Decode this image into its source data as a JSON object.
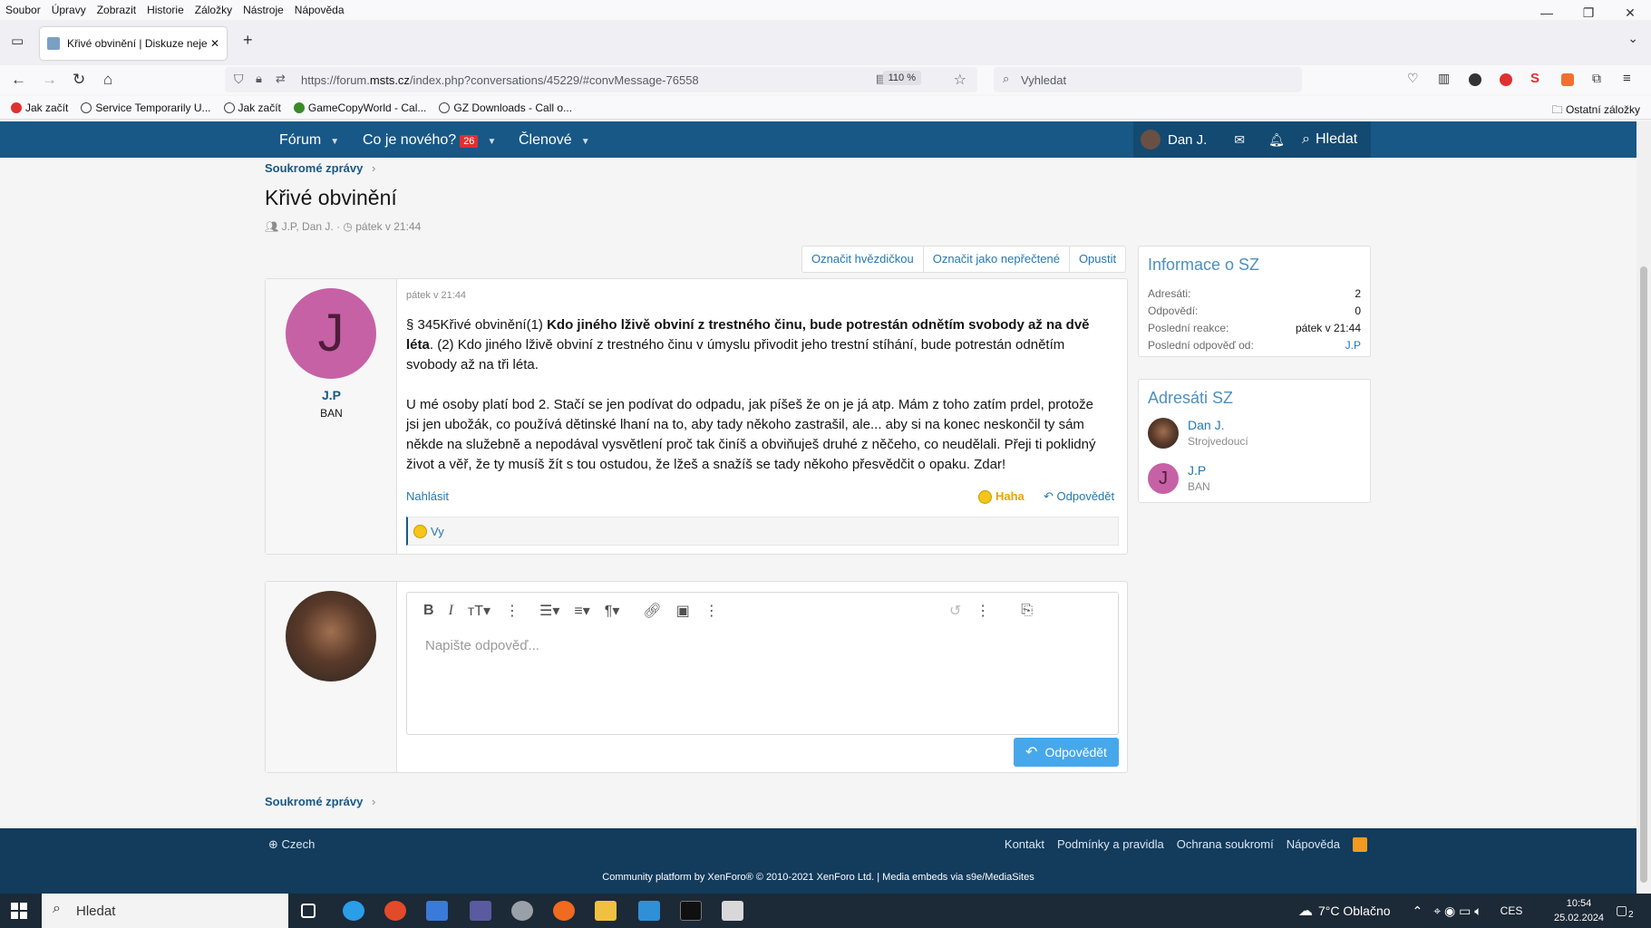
{
  "browser": {
    "menu": [
      "Soubor",
      "Úpravy",
      "Zobrazit",
      "Historie",
      "Záložky",
      "Nástroje",
      "Nápověda"
    ],
    "tab_title": "Křivé obvinění | Diskuze nejen o",
    "url_prefix": "https://forum.",
    "url_host": "msts.cz",
    "url_path": "/index.php?conversations/45229/#convMessage-76558",
    "zoom": "110 %",
    "search_placeholder": "Vyhledat",
    "bookmarks": [
      "Jak začít",
      "Service Temporarily U...",
      "Jak začít",
      "GameCopyWorld - Cal...",
      "GZ Downloads - Call o..."
    ],
    "other_bookmarks": "Ostatní záložky"
  },
  "site_nav": {
    "forum": "Fórum",
    "whats_new": "Co je nového?",
    "whats_new_count": "26",
    "members": "Členové",
    "user": "Dan J.",
    "search": "Hledat"
  },
  "breadcrumb": "Soukromé zprávy",
  "page_title": "Křivé obvinění",
  "page_meta": {
    "participants": "J.P, Dan J.",
    "separator": "·",
    "date": "pátek v 21:44"
  },
  "actions": {
    "star": "Označit hvězdičkou",
    "unread": "Označit jako nepřečtené",
    "leave": "Opustit"
  },
  "message": {
    "author_initial": "J",
    "author": "J.P",
    "author_title": "BAN",
    "date": "pátek v 21:44",
    "p1_start": "§ 345Křivé obvinění(1) ",
    "p1_bold": "Kdo jiného lživě obviní z trestného činu, bude potrestán odnětím svobody až na dvě léta",
    "p1_end": ". (2) Kdo jiného lživě obviní z trestného činu v úmyslu přivodit jeho trestní stíhání, bude potrestán odnětím svobody až na tři léta.",
    "p2": "U mé osoby platí bod 2. Stačí se jen podívat do odpadu, jak píšeš že on je já atp. Mám z toho zatím prdel, protože jsi jen ubožák, co používá dětinské lhaní na to, aby tady někoho zastrašil, ale... aby si na konec neskončil ty sám někde na služebně a nepodával vysvětlení proč tak činíš a obviňuješ druhé z něčeho, co neudělali. Přeji ti poklidný život a věř, že ty musíš žít s tou ostudou, že lžeš a snažíš se tady někoho přesvědčit o opaku. Zdar!",
    "report": "Nahlásit",
    "reaction": "Haha",
    "reply": "Odpovědět",
    "reacted_by": "Vy"
  },
  "editor": {
    "placeholder": "Napište odpověď...",
    "submit": "Odpovědět"
  },
  "sidebar": {
    "info_title": "Informace o SZ",
    "rows": [
      {
        "k": "Adresáti:",
        "v": "2"
      },
      {
        "k": "Odpovědí:",
        "v": "0"
      },
      {
        "k": "Poslední reakce:",
        "v": "pátek v 21:44"
      },
      {
        "k": "Poslední odpověď od:",
        "v": "J.P"
      }
    ],
    "recipients_title": "Adresáti SZ",
    "members": [
      {
        "name": "Dan J.",
        "title": "Strojvedoucí"
      },
      {
        "name": "J.P",
        "title": "BAN",
        "initial": "J"
      }
    ]
  },
  "footer": {
    "language": "Czech",
    "links": [
      "Kontakt",
      "Podmínky a pravidla",
      "Ochrana soukromí",
      "Nápověda"
    ],
    "copyright": "Community platform by XenForo® © 2010-2021 XenForo Ltd. | Media embeds via s9e/MediaSites"
  },
  "taskbar": {
    "search": "Hledat",
    "weather": "7°C  Oblačno",
    "lang": "CES",
    "time": "10:54",
    "date": "25.02.2024",
    "notifications": "2"
  }
}
